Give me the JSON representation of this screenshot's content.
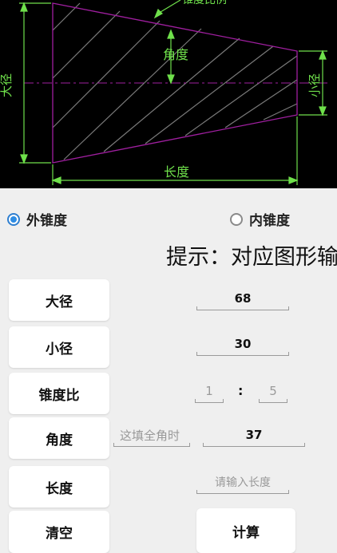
{
  "diagram": {
    "label_top": "锥度比例",
    "label_angle": "角度",
    "label_big_diameter": "大径",
    "label_small_diameter": "小径",
    "label_length": "长度"
  },
  "radio": {
    "outer_label": "外锥度",
    "inner_label": "内锥度",
    "selected": "外锥度"
  },
  "hint": "提示：对应图形输入",
  "buttons": {
    "big_diameter": "大径",
    "small_diameter": "小径",
    "taper_ratio": "锥度比",
    "angle": "角度",
    "length": "长度",
    "clear": "清空",
    "calculate": "计算"
  },
  "fields": {
    "big_diameter_value": "68",
    "small_diameter_value": "30",
    "ratio_left": "1",
    "ratio_separator": ":",
    "ratio_right": "5",
    "angle_hint_placeholder": "这填全角时",
    "angle_value": "37",
    "length_placeholder": "请输入长度"
  }
}
